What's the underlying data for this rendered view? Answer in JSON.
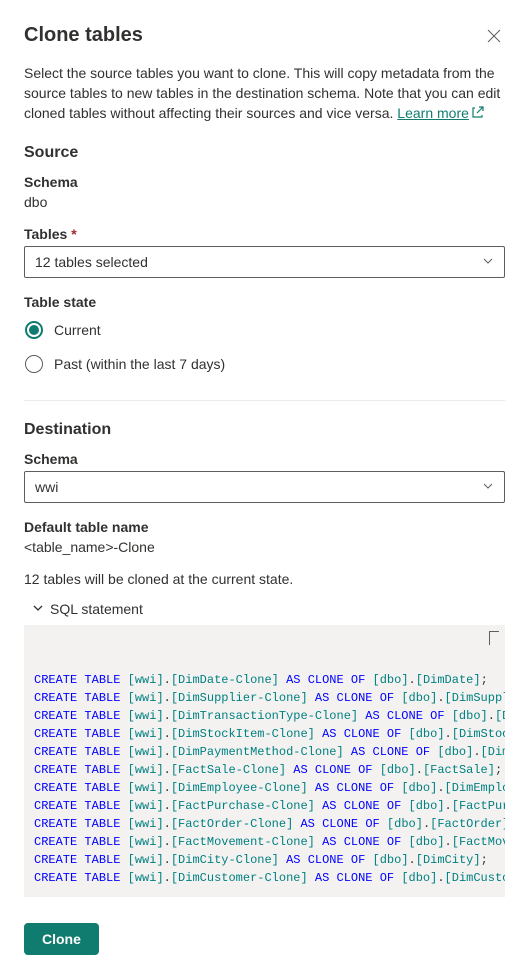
{
  "title": "Clone tables",
  "description_pre": "Select the source tables you want to clone. This will copy metadata from the source tables to new tables in the destination schema. Note that you can edit cloned tables without affecting their sources and vice versa. ",
  "learn_more": "Learn more",
  "source": {
    "heading": "Source",
    "schema_label": "Schema",
    "schema_value": "dbo",
    "tables_label": "Tables",
    "tables_selected": "12 tables selected",
    "state_label": "Table state",
    "radio_current": "Current",
    "radio_past": "Past (within the last 7 days)"
  },
  "destination": {
    "heading": "Destination",
    "schema_label": "Schema",
    "schema_value": "wwi",
    "default_name_label": "Default table name",
    "default_name_value": "<table_name>-Clone"
  },
  "status_line": "12 tables will be cloned at the current state.",
  "sql_expander": "SQL statement",
  "sql_lines": [
    {
      "dest_schema": "wwi",
      "dest_table": "DimDate-Clone",
      "src_schema": "dbo",
      "src_table": "DimDate",
      "end": ";"
    },
    {
      "dest_schema": "wwi",
      "dest_table": "DimSupplier-Clone",
      "src_schema": "dbo",
      "src_table": "DimSupplier",
      "end": ";"
    },
    {
      "dest_schema": "wwi",
      "dest_table": "DimTransactionType-Clone",
      "src_schema": "dbo",
      "src_table": "DimTra",
      "end": ""
    },
    {
      "dest_schema": "wwi",
      "dest_table": "DimStockItem-Clone",
      "src_schema": "dbo",
      "src_table": "DimStockItem",
      "end": ""
    },
    {
      "dest_schema": "wwi",
      "dest_table": "DimPaymentMethod-Clone",
      "src_schema": "dbo",
      "src_table": "DimPayme",
      "end": ""
    },
    {
      "dest_schema": "wwi",
      "dest_table": "FactSale-Clone",
      "src_schema": "dbo",
      "src_table": "FactSale",
      "end": ";"
    },
    {
      "dest_schema": "wwi",
      "dest_table": "DimEmployee-Clone",
      "src_schema": "dbo",
      "src_table": "DimEmployee",
      "end": ";"
    },
    {
      "dest_schema": "wwi",
      "dest_table": "FactPurchase-Clone",
      "src_schema": "dbo",
      "src_table": "FactPurchase",
      "end": ""
    },
    {
      "dest_schema": "wwi",
      "dest_table": "FactOrder-Clone",
      "src_schema": "dbo",
      "src_table": "FactOrder",
      "end": ";"
    },
    {
      "dest_schema": "wwi",
      "dest_table": "FactMovement-Clone",
      "src_schema": "dbo",
      "src_table": "FactMovement",
      "end": ""
    },
    {
      "dest_schema": "wwi",
      "dest_table": "DimCity-Clone",
      "src_schema": "dbo",
      "src_table": "DimCity",
      "end": ";"
    },
    {
      "dest_schema": "wwi",
      "dest_table": "DimCustomer-Clone",
      "src_schema": "dbo",
      "src_table": "DimCustomer",
      "end": ";"
    }
  ],
  "clone_button": "Clone"
}
